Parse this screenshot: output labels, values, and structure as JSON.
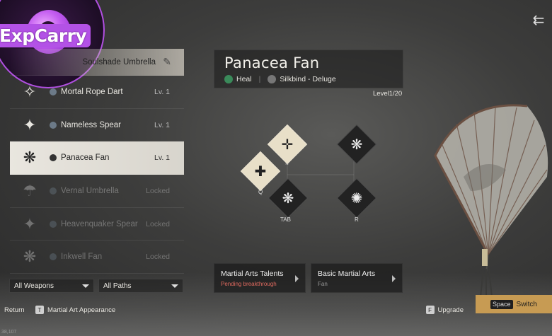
{
  "logo": {
    "text": "ExpCarry"
  },
  "weapons": [
    {
      "name": "Soulshade Umbrella",
      "level": "",
      "state": "top",
      "icon": "umbrella-icon"
    },
    {
      "name": "Mortal Rope Dart",
      "level": "Lv. 1",
      "state": "normal",
      "icon": "rope-dart-icon"
    },
    {
      "name": "Nameless Spear",
      "level": "Lv. 1",
      "state": "normal",
      "icon": "spear-icon"
    },
    {
      "name": "Panacea Fan",
      "level": "Lv. 1",
      "state": "selected",
      "icon": "fan-icon"
    },
    {
      "name": "Vernal Umbrella",
      "level": "Locked",
      "state": "locked",
      "icon": "umbrella-icon"
    },
    {
      "name": "Heavenquaker Spear",
      "level": "Locked",
      "state": "locked",
      "icon": "spear-icon"
    },
    {
      "name": "Inkwell Fan",
      "level": "Locked",
      "state": "locked",
      "icon": "fan-icon"
    }
  ],
  "filters": {
    "weapons": "All Weapons",
    "paths": "All Paths"
  },
  "header": {
    "title": "Panacea Fan",
    "tag1": "Heal",
    "tag2": "Silkbind - Deluge",
    "level": "Level1/20"
  },
  "skills": {
    "key_tilde": "~",
    "key_q": "Q",
    "key_tab": "TAB",
    "key_r": "R"
  },
  "cards": [
    {
      "title": "Martial Arts Talents",
      "subtitle": "Pending breakthrough"
    },
    {
      "title": "Basic Martial Arts",
      "subtitle": "Fan"
    }
  ],
  "bottom": {
    "return": "Return",
    "appearance_key": "T",
    "appearance": "Martial Art Appearance",
    "upgrade_key": "F",
    "upgrade": "Upgrade",
    "switch_key": "Space",
    "switch": "Switch"
  },
  "coords": "38,107",
  "colors": {
    "accent": "#c79b53",
    "logo": "#b352e6",
    "pending": "#e06a5f"
  }
}
